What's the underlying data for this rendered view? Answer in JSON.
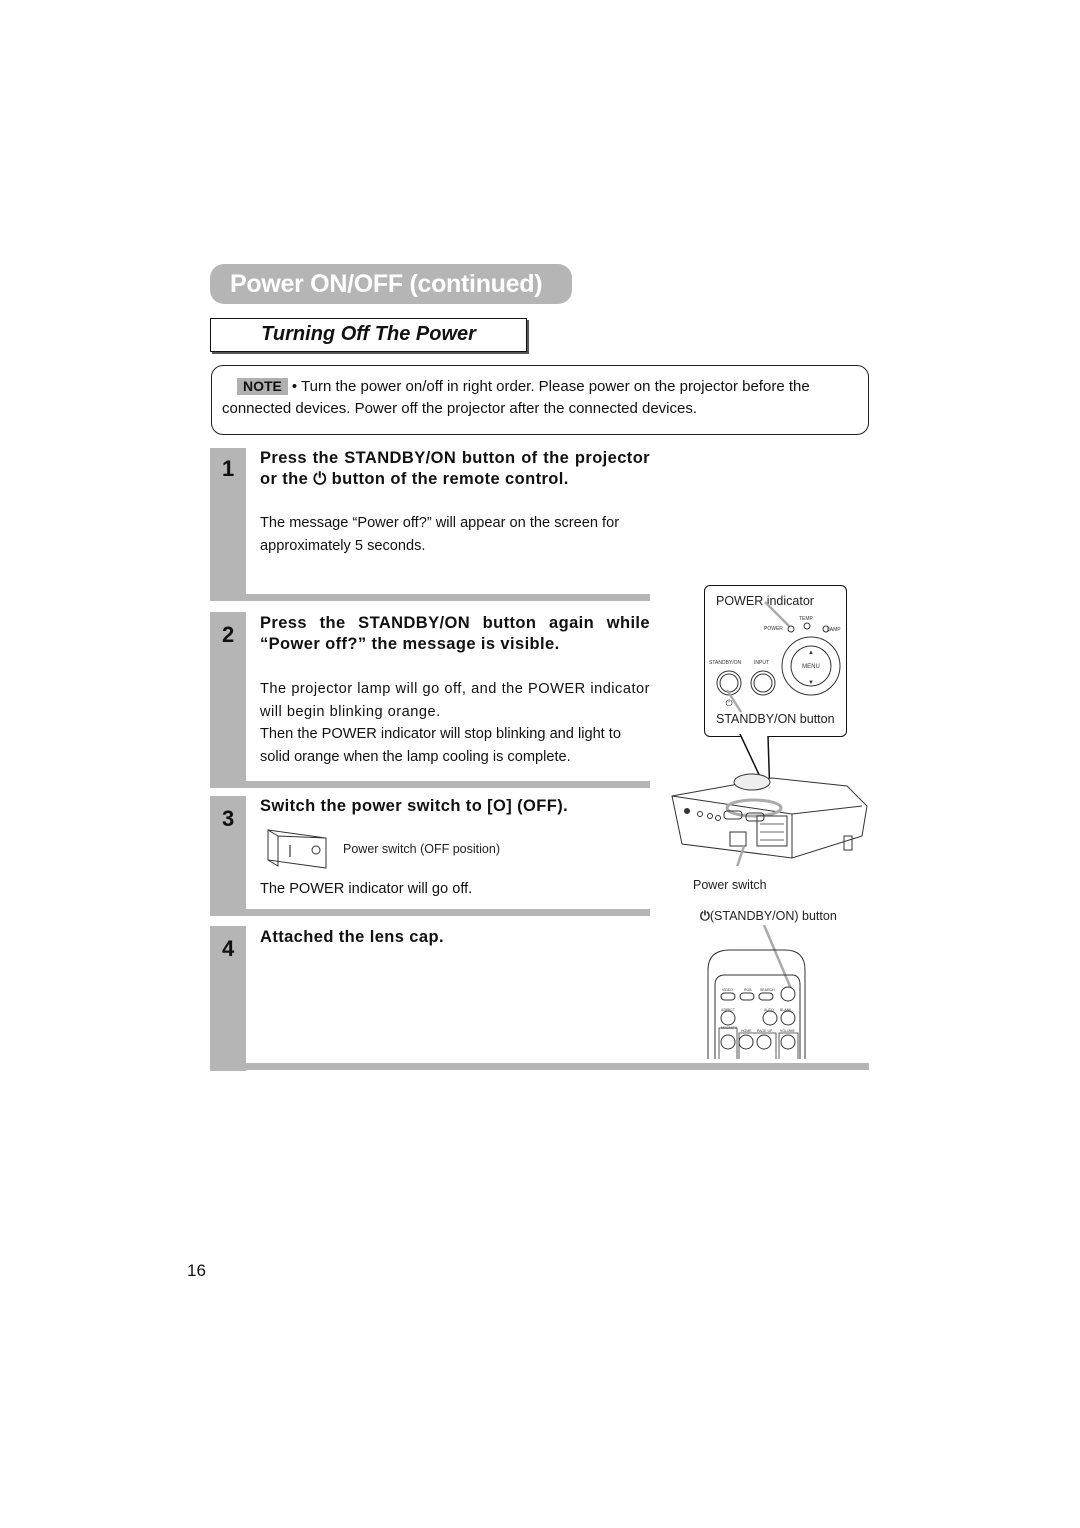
{
  "header": {
    "section_title": "Power ON/OFF (continued)",
    "subsection_title": "Turning Off The Power"
  },
  "note": {
    "badge": "NOTE",
    "text": "• Turn the power on/off in right order. Please power on the projector before the connected devices. Power off the projector after the connected devices."
  },
  "steps": [
    {
      "number": "1",
      "heading": "Press the STANDBY/ON button of the projector or the ⏻ button of the remote control.",
      "body": [
        "The message “Power off?” will appear on the screen for approximately 5 seconds."
      ]
    },
    {
      "number": "2",
      "heading": "Press the STANDBY/ON button again while “Power off?” the message is visible.",
      "body": [
        "The projector lamp will go off, and the POWER indicator will begin blinking orange.",
        "Then the POWER indicator will stop blinking and light to solid orange when the lamp cooling is complete."
      ]
    },
    {
      "number": "3",
      "heading": "Switch the power switch to [O] (OFF).",
      "switch_caption": "Power switch (OFF position)",
      "body": [
        "The POWER indicator will go off."
      ]
    },
    {
      "number": "4",
      "heading": "Attached the lens cap.",
      "body": []
    }
  ],
  "figures": {
    "control_panel": {
      "power_indicator_label": "POWER indicator",
      "standby_button_label": "STANDBY/ON button",
      "panel_labels": {
        "power": "POWER",
        "temp": "TEMP",
        "lamp": "LAMP",
        "standby_on": "STANDBY/ON",
        "input": "INPUT",
        "menu": "◄MENU►"
      }
    },
    "projector": {
      "power_switch_label": "Power switch"
    },
    "remote": {
      "standby_label": "(STANDBY/ON) button",
      "buttons": [
        "VIDEO",
        "RGB",
        "SEARCH",
        "ASPECT",
        "AUTO",
        "BLANK",
        "MAGNIFY",
        "HOME",
        "PAGE UP",
        "VOLUME"
      ]
    }
  },
  "footer": {
    "page_number": "16"
  },
  "colors": {
    "accent_gray": "#b5b5b5",
    "text": "#111111"
  }
}
